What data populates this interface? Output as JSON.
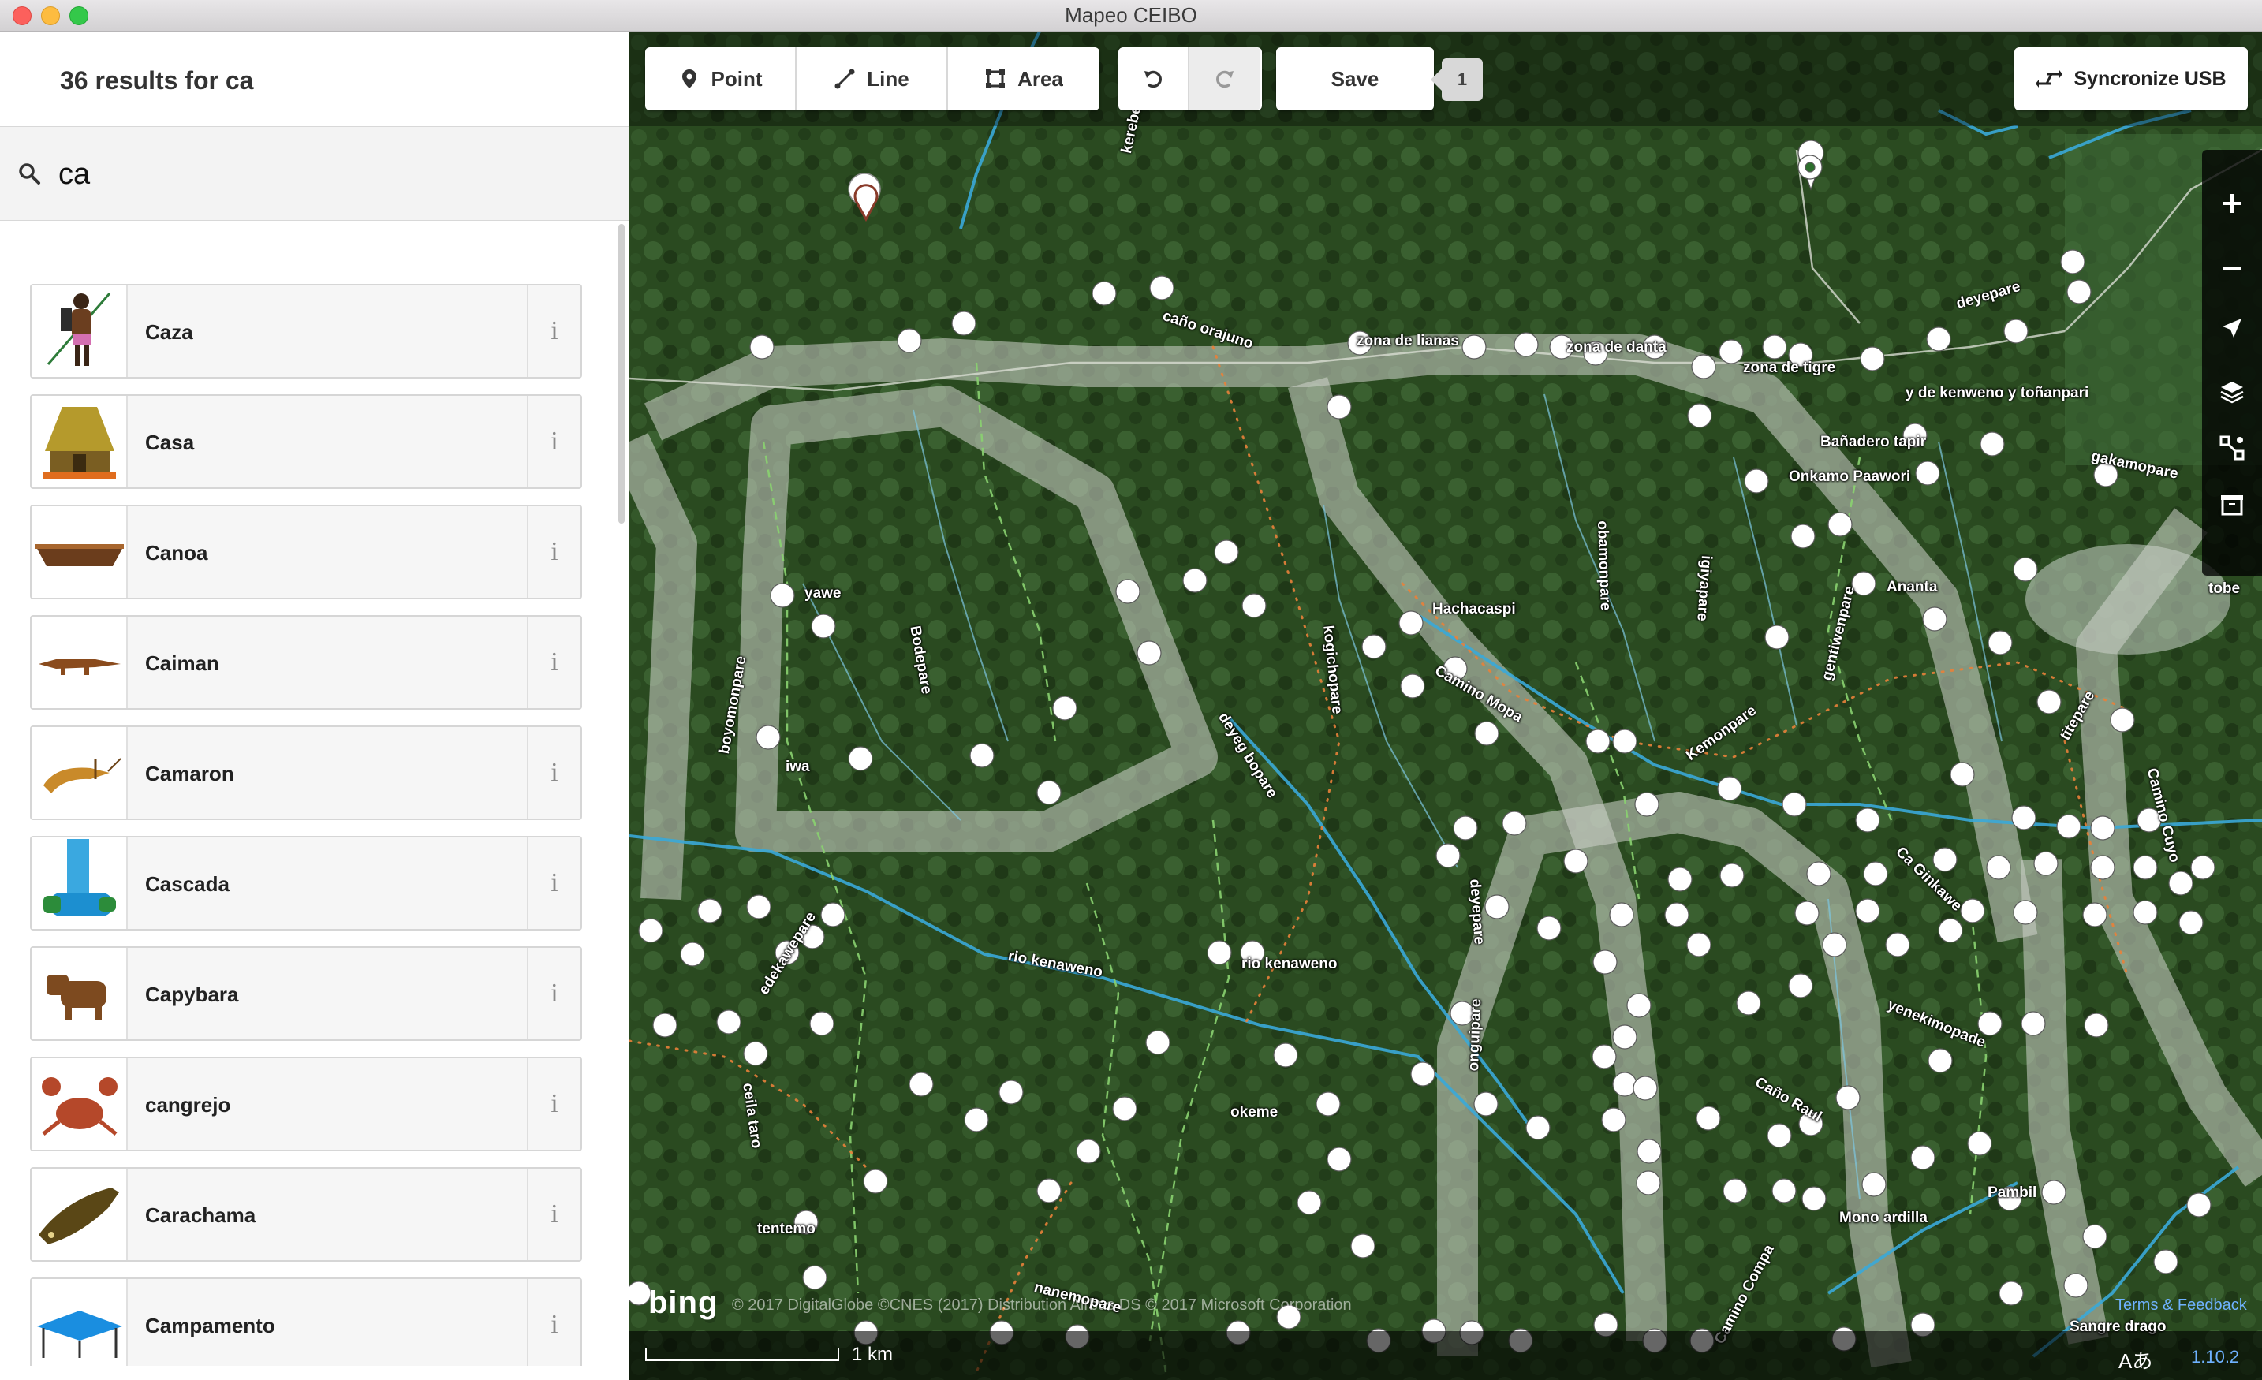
{
  "window": {
    "title": "Mapeo CEIBO"
  },
  "sidebar": {
    "results_title": "36 results for ca",
    "search": {
      "value": "ca",
      "placeholder": ""
    },
    "items": [
      {
        "label": "Caza",
        "icon": "hunter-icon",
        "info": "i"
      },
      {
        "label": "Casa",
        "icon": "hut-icon",
        "info": "i"
      },
      {
        "label": "Canoa",
        "icon": "canoe-icon",
        "info": "i"
      },
      {
        "label": "Caiman",
        "icon": "caiman-icon",
        "info": "i"
      },
      {
        "label": "Camaron",
        "icon": "shrimp-icon",
        "info": "i"
      },
      {
        "label": "Cascada",
        "icon": "waterfall-icon",
        "info": "i"
      },
      {
        "label": "Capybara",
        "icon": "capybara-icon",
        "info": "i"
      },
      {
        "label": "cangrejo",
        "icon": "crab-icon",
        "info": "i"
      },
      {
        "label": "Carachama",
        "icon": "fish-icon",
        "info": "i"
      },
      {
        "label": "Campamento",
        "icon": "tent-icon",
        "info": "i"
      }
    ]
  },
  "toolbar": {
    "point_label": "Point",
    "line_label": "Line",
    "area_label": "Area",
    "save_label": "Save",
    "pending_count": "1",
    "sync_label": "Syncronize USB"
  },
  "map": {
    "labels": [
      "kerebepare",
      "caño orajuno",
      "zona de lianas",
      "zona de danta",
      "zona de tigre",
      "deyepare",
      "y de kenweno y toñanpari",
      "Bañadero tapir",
      "Onkamo Paawori",
      "gakamopare",
      "yawe",
      "Bodepare",
      "boyomonpare",
      "iwa",
      "Hachacaspi",
      "obamonpare",
      "igiyapare",
      "gentiwenpare",
      "Ananta",
      "tobe",
      "Camino Mopa",
      "deyeg bopare",
      "kogichopare",
      "Kemonpare",
      "titepare",
      "Camino Cuyo",
      "Ca Ginkawe",
      "rio kenaweno",
      "rio kenaweno",
      "edekawepare",
      "yenekimopade",
      "deyepare",
      "onguipare",
      "okeme",
      "ceila taro",
      "Caño Raul",
      "Pambil",
      "Mono ardilla",
      "tentemo",
      "nanemopare",
      "Camino Compa",
      "Sangre drago"
    ],
    "attribution": "© 2017 DigitalGlobe ©CNES (2017) Distribution Airbus DS © 2017 Microsoft Corporation",
    "brand": "bing",
    "terms": "Terms & Feedback",
    "scale_label": "1 km",
    "language_glyph": "Aあ",
    "version": "1.10.2"
  }
}
